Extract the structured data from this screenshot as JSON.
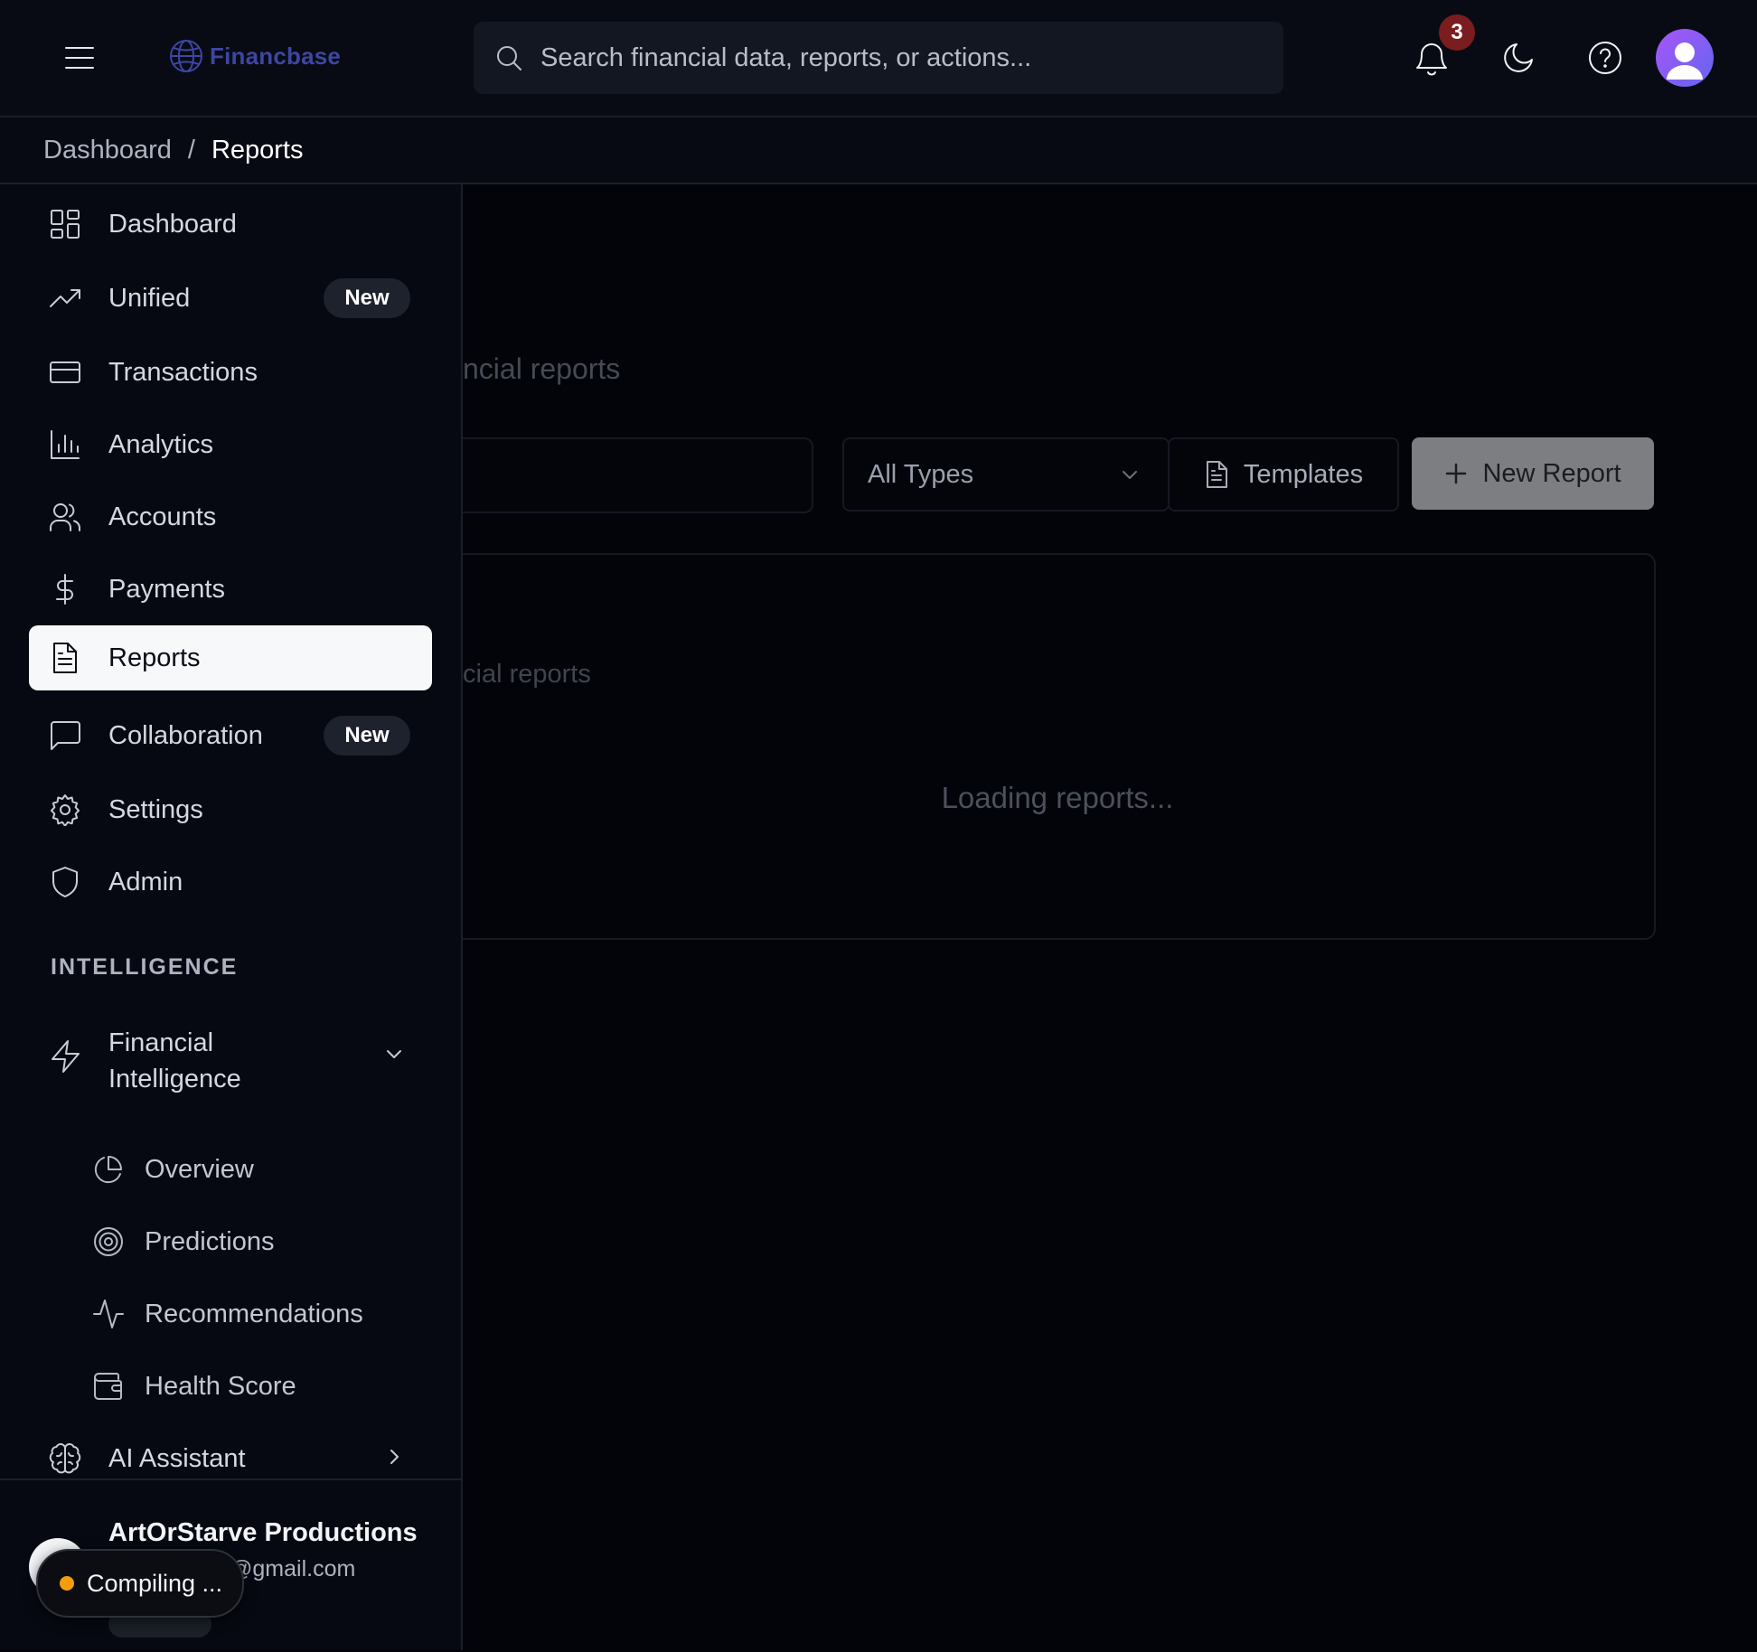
{
  "app": {
    "name": "Financbase"
  },
  "header": {
    "search_placeholder": "Search financial data, reports, or actions...",
    "notification_count": "3",
    "accent_color": "#7c5cf6"
  },
  "breadcrumb": {
    "items": [
      "Dashboard",
      "Reports"
    ],
    "separator": "/"
  },
  "sidebar": {
    "items": [
      {
        "label": "Dashboard",
        "icon": "dashboard-grid-icon"
      },
      {
        "label": "Unified",
        "icon": "trending-up-icon",
        "badge": "New"
      },
      {
        "label": "Transactions",
        "icon": "credit-card-icon"
      },
      {
        "label": "Analytics",
        "icon": "bar-chart-icon"
      },
      {
        "label": "Accounts",
        "icon": "users-icon"
      },
      {
        "label": "Payments",
        "icon": "dollar-sign-icon"
      },
      {
        "label": "Reports",
        "icon": "file-text-icon",
        "active": true
      },
      {
        "label": "Collaboration",
        "icon": "message-square-icon",
        "badge": "New"
      },
      {
        "label": "Settings",
        "icon": "gear-icon"
      },
      {
        "label": "Admin",
        "icon": "shield-icon"
      }
    ],
    "section_label": "INTELLIGENCE",
    "intelligence": {
      "label": "Financial Intelligence",
      "icon": "zap-icon",
      "children": [
        {
          "label": "Overview",
          "icon": "pie-chart-icon"
        },
        {
          "label": "Predictions",
          "icon": "target-icon"
        },
        {
          "label": "Recommendations",
          "icon": "activity-icon"
        },
        {
          "label": "Health Score",
          "icon": "wallet-icon"
        }
      ]
    },
    "ai_assistant": {
      "label": "AI Assistant",
      "icon": "brain-icon"
    },
    "user": {
      "name": "ArtOrStarve Productions",
      "email_visible": "@gmail.com"
    }
  },
  "main": {
    "subtitle_visible": "ncial reports",
    "filter_type": "All Types",
    "templates_label": "Templates",
    "new_report_label": "New Report",
    "panel_subtitle_visible": "cial reports",
    "loading_text": "Loading reports..."
  },
  "toast": {
    "text": "Compiling ..."
  }
}
